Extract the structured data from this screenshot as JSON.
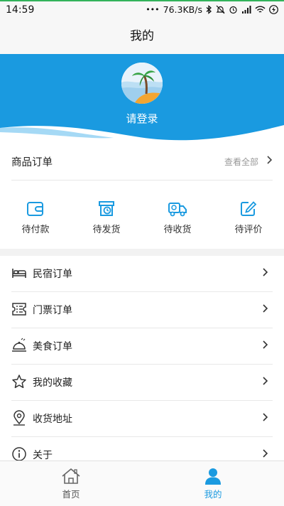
{
  "status_bar": {
    "time": "14:59",
    "speed": "76.3KB/s",
    "icons": [
      "dots-icon",
      "bluetooth-icon",
      "mute-icon",
      "alarm-icon",
      "signal-icon",
      "wifi-icon",
      "battery-charging-icon"
    ]
  },
  "header": {
    "title": "我的"
  },
  "profile": {
    "login_text": "请登录"
  },
  "orders": {
    "title": "商品订单",
    "view_all": "查看全部",
    "items": [
      {
        "label": "待付款",
        "icon": "wallet-icon"
      },
      {
        "label": "待发货",
        "icon": "package-clock-icon"
      },
      {
        "label": "待收货",
        "icon": "delivery-truck-icon"
      },
      {
        "label": "待评价",
        "icon": "edit-review-icon"
      }
    ]
  },
  "menu": [
    {
      "label": "民宿订单",
      "icon": "bed-icon"
    },
    {
      "label": "门票订单",
      "icon": "ticket-icon"
    },
    {
      "label": "美食订单",
      "icon": "food-cloche-icon"
    },
    {
      "label": "我的收藏",
      "icon": "star-icon"
    },
    {
      "label": "收货地址",
      "icon": "location-pin-icon"
    },
    {
      "label": "关于",
      "icon": "info-icon"
    }
  ],
  "bottom_nav": [
    {
      "label": "首页",
      "icon": "home-icon",
      "active": false
    },
    {
      "label": "我的",
      "icon": "user-icon",
      "active": true
    }
  ],
  "colors": {
    "accent": "#1a9ae0",
    "inactive": "#555555",
    "divider": "#e8e8e8"
  }
}
